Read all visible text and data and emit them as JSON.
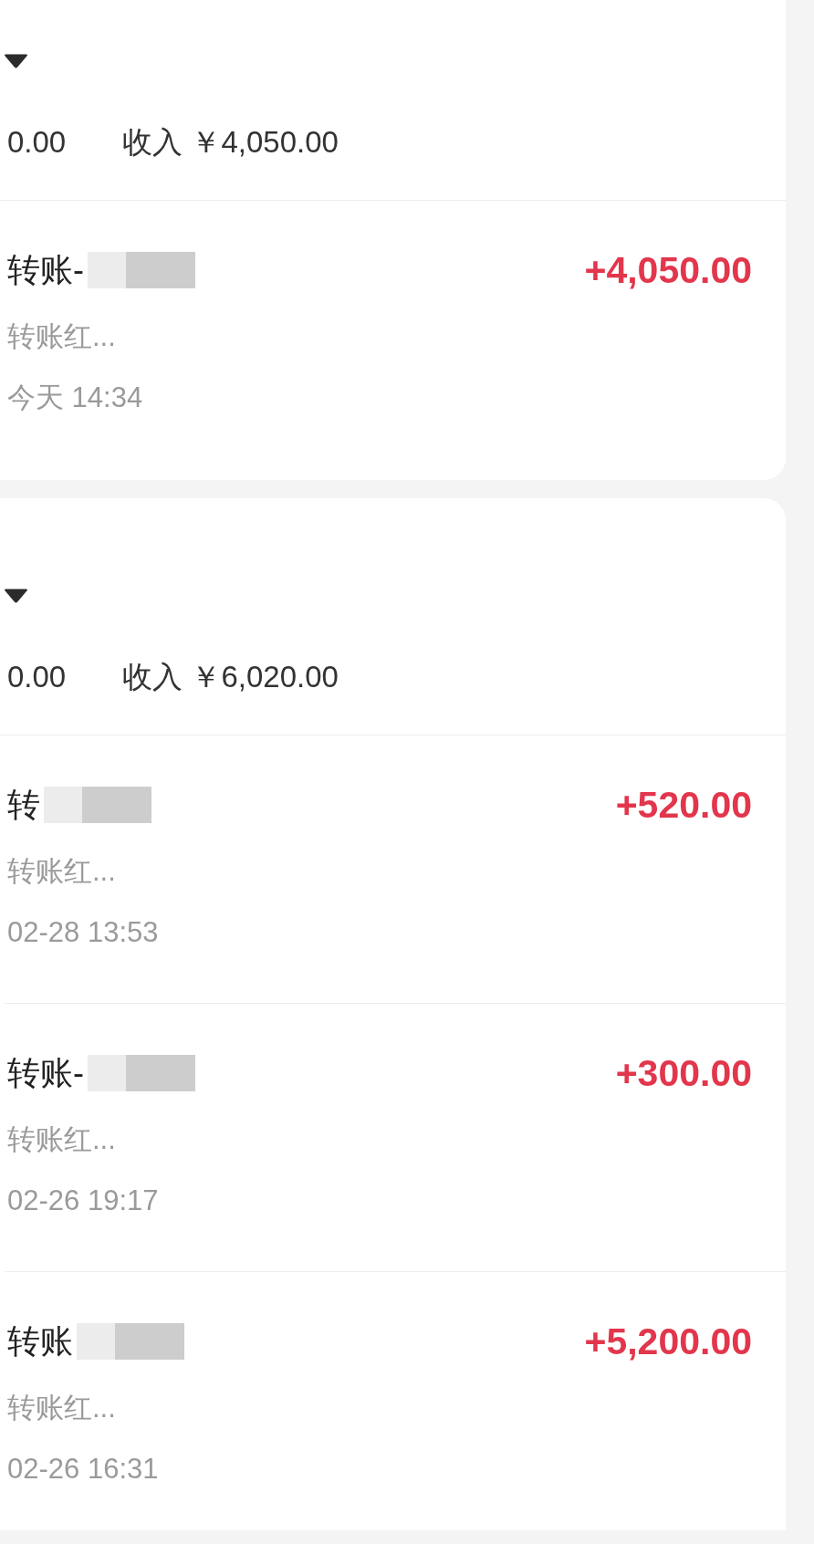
{
  "groups": [
    {
      "totals": [
        "0.00",
        "收入 ￥4,050.00"
      ],
      "transactions": [
        {
          "title": "转账-",
          "redacted": true,
          "note": "转账红...",
          "time": "今天 14:34",
          "amount": "+4,050.00"
        }
      ]
    },
    {
      "totals": [
        "0.00",
        "收入 ￥6,020.00"
      ],
      "transactions": [
        {
          "title": "转",
          "redacted": true,
          "note": "转账红...",
          "time": "02-28 13:53",
          "amount": "+520.00"
        },
        {
          "title": "转账-",
          "redacted": true,
          "note": "转账红...",
          "time": "02-26 19:17",
          "amount": "+300.00"
        },
        {
          "title": "转账",
          "redacted": true,
          "note": "转账红...",
          "time": "02-26 16:31",
          "amount": "+5,200.00"
        }
      ]
    }
  ]
}
